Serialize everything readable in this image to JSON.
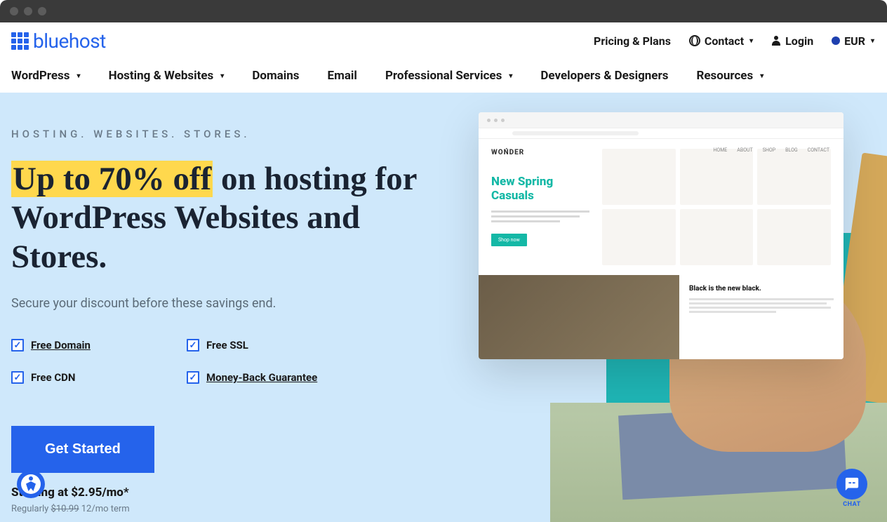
{
  "logo": {
    "text": "bluehost"
  },
  "topNav": {
    "pricing": "Pricing & Plans",
    "contact": "Contact",
    "login": "Login",
    "currency": "EUR"
  },
  "mainNav": {
    "wordpress": "WordPress",
    "hosting": "Hosting & Websites",
    "domains": "Domains",
    "email": "Email",
    "services": "Professional Services",
    "developers": "Developers & Designers",
    "resources": "Resources"
  },
  "hero": {
    "eyebrow": "HOSTING. WEBSITES. STORES.",
    "highlight": "Up to 70% off",
    "headline_rest": " on hosting for WordPress Websites and Stores.",
    "subtext": "Secure your discount before these savings end.",
    "features": {
      "freeDomain": "Free Domain",
      "freeSSL": "Free SSL",
      "freeCDN": "Free CDN",
      "moneyBack": "Money-Back Guarantee"
    },
    "cta": "Get Started",
    "price_prefix": "Starting at ",
    "price_value": "$2.95/mo*",
    "reg_prefix": "Regularly ",
    "reg_strike": "$10.99",
    "reg_suffix": " 12/mo term"
  },
  "chat": {
    "label": "CHAT"
  },
  "mockup": {
    "brand": "WOŃDER",
    "nav": {
      "home": "HOME",
      "about": "ABOUT",
      "shop": "SHOP",
      "blog": "BLOG",
      "contact": "CONTACT"
    },
    "headline": "New Spring Casuals",
    "button": "Shop now",
    "card_title": "Black is the new black."
  }
}
